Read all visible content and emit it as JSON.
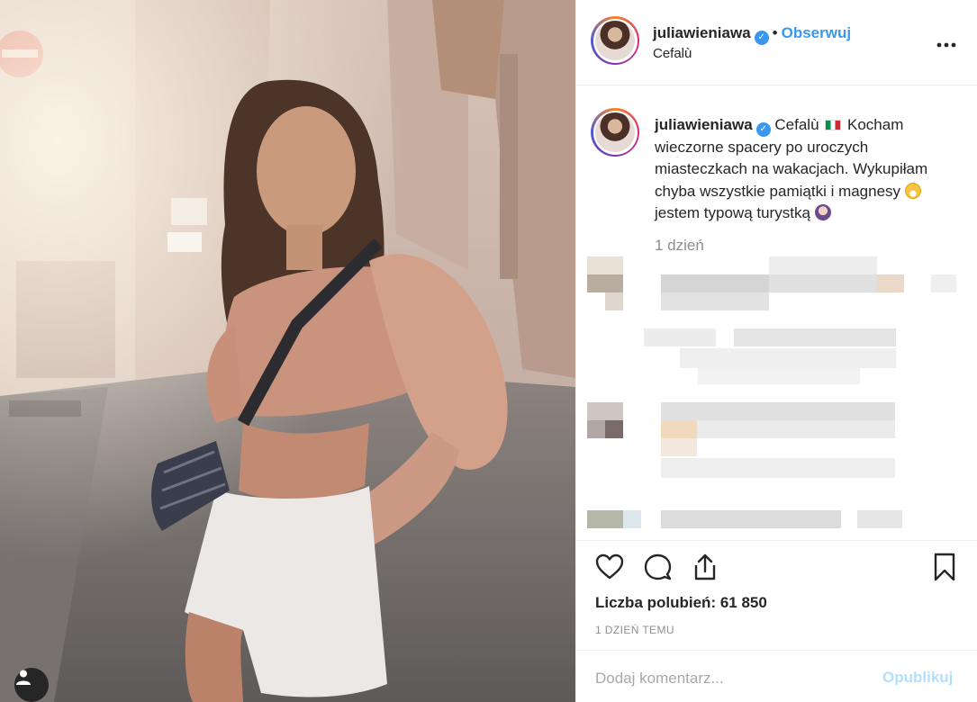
{
  "post": {
    "username": "juliawieniawa",
    "verified": true,
    "separator": "•",
    "follow_label": "Obserwuj",
    "location": "Cefalù",
    "more_icon": "more-horizontal-icon"
  },
  "caption": {
    "username": "juliawieniawa",
    "location_tag": "Cefalù",
    "text_part1": "Kocham wieczorne spacery po uroczych miasteczkach na wakacjach. Wykupiłam chyba wszystkie pamiątki i magnesy",
    "text_part2": "jestem typową turystką",
    "time_ago": "1 dzień"
  },
  "actions": {
    "like_icon": "heart-icon",
    "comment_icon": "comment-icon",
    "share_icon": "share-icon",
    "save_icon": "bookmark-icon",
    "likes_label": "Liczba polubień: 61 850",
    "date_label": "1 DZIEŃ TEMU"
  },
  "comment_box": {
    "placeholder": "Dodaj komentarz...",
    "post_label": "Opublikuj"
  },
  "colors": {
    "link": "#3897f0",
    "muted": "#8e8e8e",
    "post_disabled": "#b2dffc"
  }
}
